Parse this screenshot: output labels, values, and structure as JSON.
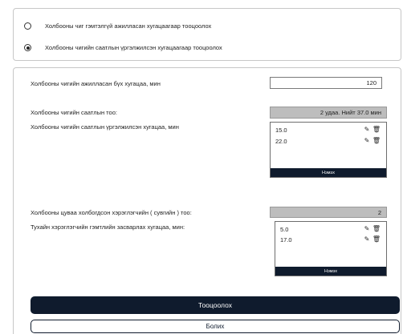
{
  "mode_options": [
    {
      "label": "Холбооны чиг гэмтэлгүй ажилласан хугацаагаар тооцоолох",
      "selected": false
    },
    {
      "label": "Холбооны чигийн саатлын үргэлжилсэн хугацаагаар тооцоолох",
      "selected": true
    }
  ],
  "total_time": {
    "label": "Холбооны чигийн ажилласан бүх хугацаа, мин",
    "value": "120"
  },
  "outage_count": {
    "label": "Холбооны чигийн саатлын тоо:",
    "value": "2 удаа.  Нийт 37.0 мин"
  },
  "outage_durations": {
    "label": "Холбооны чигийн саатлын үргэлжилсэн хугацаа, мин",
    "items": [
      "15.0",
      "22.0"
    ],
    "footer_label": "Нэмэх"
  },
  "channel_count": {
    "label": "Холбооны цуваа холбогдсон хэрэглэгчийн ( сувгийн ) тоо:",
    "value": "2"
  },
  "repair_durations": {
    "label": "Тухайн хэрэглэгчийн гэмтлийн засварлах хугацаа, мин:",
    "items": [
      "5.0",
      "17.0"
    ],
    "footer_label": "Нэмэх"
  },
  "actions": {
    "calculate_label": "Тооцоолох",
    "cancel_label": "Болих"
  },
  "icons": {
    "edit": "pencil-icon",
    "delete": "trash-icon"
  },
  "colors": {
    "accent": "#0f1b2d",
    "readonly_bg": "#bdbdbd"
  }
}
